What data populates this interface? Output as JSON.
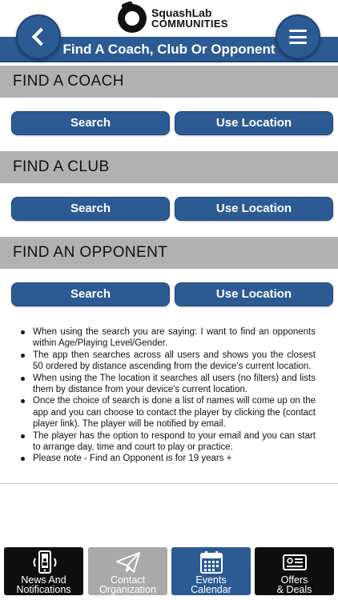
{
  "header": {
    "logo_line1": "SquashLab",
    "logo_line2": "COMMUNITIES",
    "title": "Find A Coach, Club Or Opponent"
  },
  "sections": [
    {
      "heading": "FIND A COACH",
      "search_label": "Search",
      "location_label": "Use Location"
    },
    {
      "heading": "FIND A CLUB",
      "search_label": "Search",
      "location_label": "Use Location"
    },
    {
      "heading": "FIND AN OPPONENT",
      "search_label": "Search",
      "location_label": "Use Location"
    }
  ],
  "info": [
    "When using the search you are saying: I want to find an opponents within Age/Playing Level/Gender.",
    "The app then searches across all users and shows you the closest 50 ordered by distance ascending from the device's current location.",
    "When using the The location it searches all users (no filters) and lists them by distance from your device's current location.",
    "Once the choice of search is done a list of names will come up on the app and you can choose to contact the player by clicking the (contact player link). The player will be notified by email.",
    "The player has the option to respond to your email and you can start to arrange day, time and court to play or practice.",
    "Please note - Find an Opponent is for 19 years +"
  ],
  "nav": [
    {
      "line1": "News And",
      "line2": "Notifications",
      "icon": "phone-notification-icon",
      "color": "#0f0f0f"
    },
    {
      "line1": "Contact",
      "line2": "Organization",
      "icon": "paper-plane-icon",
      "color": "#a9a9a9"
    },
    {
      "line1": "Events",
      "line2": "Calendar",
      "icon": "calendar-icon",
      "color": "#2c5b94"
    },
    {
      "line1": "Offers",
      "line2": "& Deals",
      "icon": "voucher-icon",
      "color": "#0f0f0f"
    }
  ],
  "colors": {
    "primary_blue": "#2c5b94",
    "section_gray": "#b1b1b1",
    "nav_dark": "#0f0f0f"
  },
  "icons": {
    "back": "chevron-left-icon",
    "menu": "hamburger-menu-icon"
  }
}
